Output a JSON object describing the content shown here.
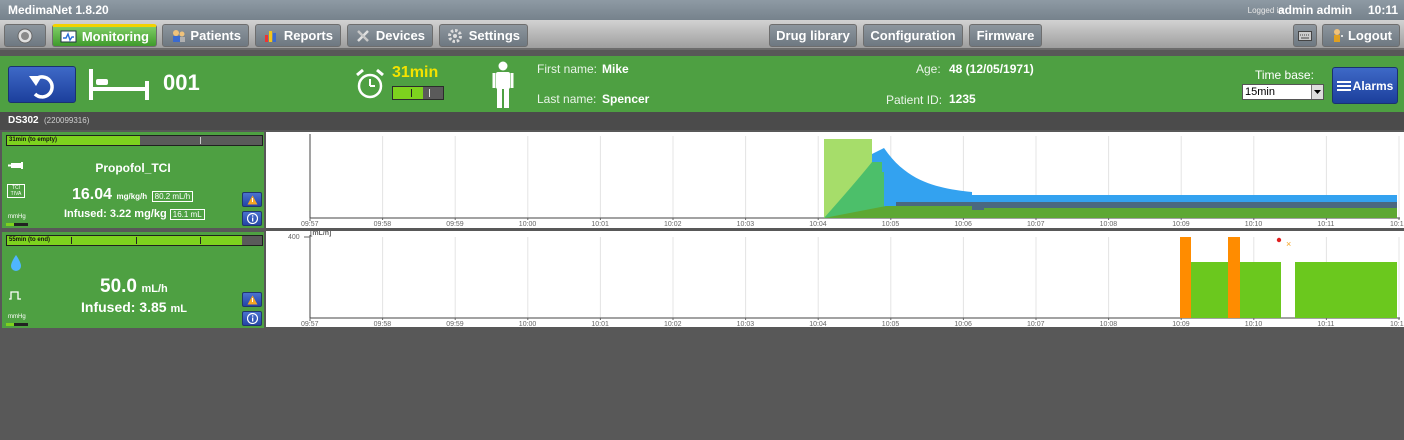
{
  "app": {
    "title": "MedimaNet 1.8.20",
    "logged_in_label": "Logged in:",
    "user": "admin admin",
    "clock": "10:11"
  },
  "menu": {
    "left": [
      {
        "label": "Monitoring",
        "icon": "monitor-icon",
        "active": true
      },
      {
        "label": "Patients",
        "icon": "patients-icon",
        "active": false
      },
      {
        "label": "Reports",
        "icon": "reports-icon",
        "active": false
      },
      {
        "label": "Devices",
        "icon": "tools-icon",
        "active": false
      },
      {
        "label": "Settings",
        "icon": "gear-icon",
        "active": false
      }
    ],
    "center": [
      "Drug library",
      "Configuration",
      "Firmware"
    ],
    "logout": "Logout"
  },
  "patient": {
    "bed": "001",
    "time_left": "31min",
    "time_bar_fraction": 0.6,
    "first_name_label": "First name:",
    "first_name": "Mike",
    "last_name_label": "Last name:",
    "last_name": "Spencer",
    "age_label": "Age:",
    "age": "48 (12/05/1971)",
    "id_label": "Patient ID:",
    "id": "1235",
    "timebase_label": "Time base:",
    "timebase": "15min",
    "alarms": "Alarms"
  },
  "device": {
    "name": "DS302",
    "serial": "(220099316)"
  },
  "pumps": [
    {
      "bar_text": "31min (to empty)",
      "bar_fraction": 0.52,
      "drug": "Propofol_TCI",
      "tci_badge": "TCI TIVA",
      "rate": "16.04",
      "rate_unit": "mg/kg/h",
      "rate_box": "80.2 mL/h",
      "infused_label": "Infused: 3.22 mg/kg",
      "infused_box": "16.1 mL",
      "mmhg": "mmHg"
    },
    {
      "bar_text": "55min (to end)",
      "bar_fraction": 0.92,
      "rate": "50.0",
      "rate_unit": "mL/h",
      "infused_label": "Infused: 3.85",
      "infused_unit": "mL",
      "mmhg": "mmHg"
    }
  ],
  "chart_times": [
    "09:57",
    "09:58",
    "09:59",
    "10:00",
    "10:01",
    "10:02",
    "10:03",
    "10:04",
    "10:05",
    "10:06",
    "10:07",
    "10:08",
    "10:09",
    "10:10",
    "10:11",
    "10:12"
  ],
  "chart2": {
    "ymax_label": "400",
    "unit_label": "[mL/h]"
  },
  "colors": {
    "header_green": "#4ea042",
    "bar_green": "#7dd21e",
    "chart_blue": "#33a2f0",
    "chart_dark": "#4a6880",
    "chart_green": "#6bc81e",
    "chart_orange": "#ff8c00",
    "alarm_yellow": "#f4e300"
  }
}
